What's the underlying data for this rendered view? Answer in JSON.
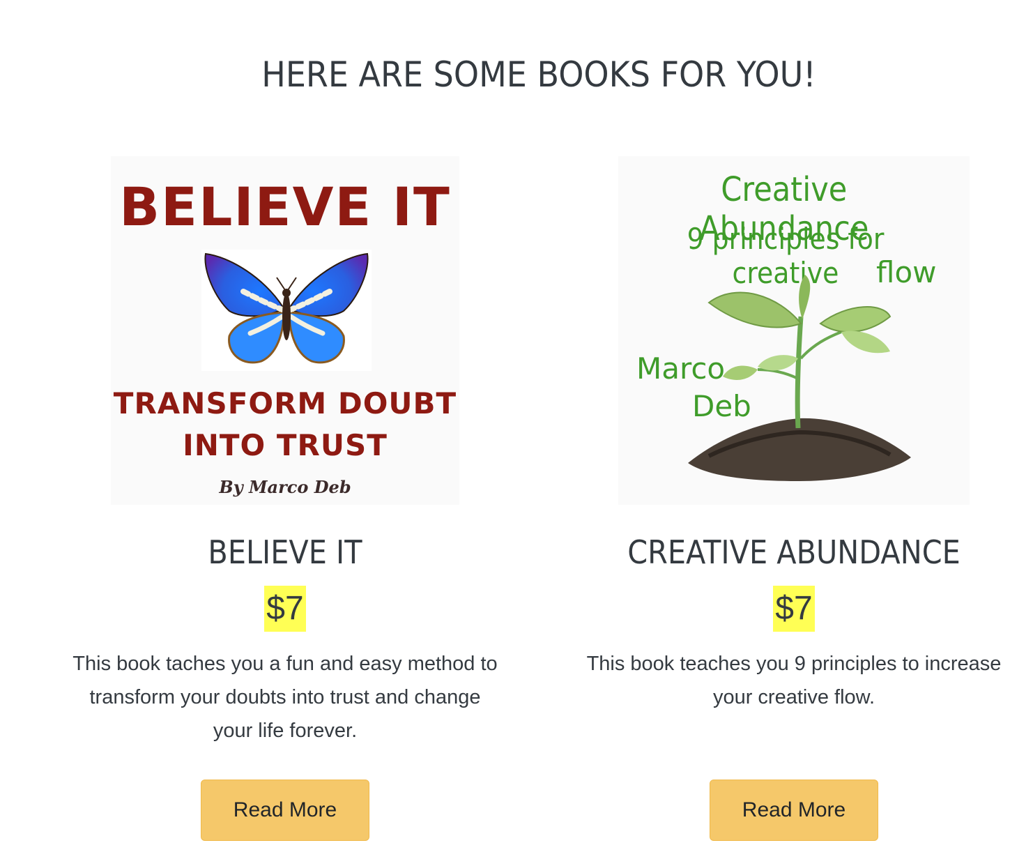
{
  "page": {
    "heading": "HERE ARE SOME BOOKS FOR YOU!"
  },
  "books": [
    {
      "cover": {
        "title": "BELIEVE IT",
        "subtitle_line1": "TRANSFORM DOUBT",
        "subtitle_line2": "INTO TRUST",
        "author": "By Marco Deb",
        "image_icon": "butterfly-icon"
      },
      "title": "BELIEVE IT",
      "price": "$7",
      "description": "This book taches you a fun and easy method to transform your doubts into trust and change your life forever.",
      "button_label": "Read More"
    },
    {
      "cover": {
        "title": "Creative Abundance",
        "subtitle_line1": "9 principles for creative",
        "subtitle_line2": "flow",
        "author_line1": "Marco",
        "author_line2": "Deb",
        "image_icon": "seedling-icon"
      },
      "title": "CREATIVE ABUNDANCE",
      "price": "$7",
      "description": "This book teaches you 9 principles to increase your creative flow.",
      "button_label": "Read More"
    }
  ],
  "colors": {
    "heading_text": "#343a40",
    "price_highlight": "#ffff55",
    "button_bg": "#f5c86a",
    "cover1_text": "#8e1a12",
    "cover2_text": "#3f9c2a"
  }
}
